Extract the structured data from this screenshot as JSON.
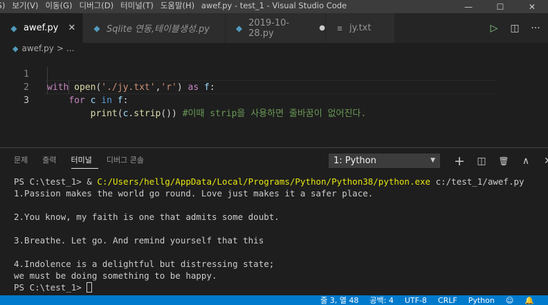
{
  "menu": [
    "선택(S)",
    "보기(V)",
    "이동(G)",
    "디버그(D)",
    "터미널(T)",
    "도움말(H)"
  ],
  "window_title": "awef.py - test_1 - Visual Studio Code",
  "window_controls": {
    "minimize": "—",
    "maximize": "☐",
    "close": "✕"
  },
  "tabs": [
    {
      "label": "awef.py",
      "icon": "python-icon",
      "active": true,
      "close": "✕"
    },
    {
      "label": "Sqlite 연동,테이블생성.py",
      "icon": "python-icon",
      "active": false
    },
    {
      "label": "2019-10-28.py",
      "icon": "python-icon",
      "active": false,
      "dot": "●"
    },
    {
      "label": "jy.txt",
      "icon": "text-file-icon",
      "active": false
    }
  ],
  "tab_actions": {
    "run": "▷",
    "split": "◫",
    "more": "···"
  },
  "breadcrumb": {
    "file": "awef.py",
    "sep": ">",
    "rest": "..."
  },
  "editor": {
    "lines": [
      {
        "num": "1",
        "tokens": [
          [
            "kw",
            "with"
          ],
          [
            "",
            " "
          ],
          [
            "fn",
            "open"
          ],
          [
            "",
            "("
          ],
          [
            "str",
            "'./jy.txt'"
          ],
          [
            "",
            ","
          ],
          [
            "str",
            "'r'"
          ],
          [
            "",
            ") "
          ],
          [
            "kw",
            "as"
          ],
          [
            "",
            " "
          ],
          [
            "var",
            "f"
          ],
          [
            "",
            ":"
          ]
        ]
      },
      {
        "num": "2",
        "tokens": [
          [
            "",
            "    "
          ],
          [
            "kw",
            "for"
          ],
          [
            "",
            " "
          ],
          [
            "var",
            "c"
          ],
          [
            "",
            " "
          ],
          [
            "kw2",
            "in"
          ],
          [
            "",
            " "
          ],
          [
            "var",
            "f"
          ],
          [
            "",
            ":"
          ]
        ]
      },
      {
        "num": "3",
        "tokens": [
          [
            "",
            "        "
          ],
          [
            "fn",
            "print"
          ],
          [
            "",
            "("
          ],
          [
            "var",
            "c"
          ],
          [
            "",
            "."
          ],
          [
            "fn",
            "strip"
          ],
          [
            "",
            "()) "
          ],
          [
            "cmt",
            "#이때 strip을 사용하면 줄바꿈이 없어진다."
          ]
        ]
      }
    ]
  },
  "panel": {
    "tabs": [
      {
        "label": "문제",
        "active": false
      },
      {
        "label": "출력",
        "active": false
      },
      {
        "label": "터미널",
        "active": true
      },
      {
        "label": "디버그 콘솔",
        "active": false
      }
    ],
    "terminal_select": "1: Python",
    "terminal_select_arrow": "▼",
    "actions": {
      "add": "+",
      "split": "◫",
      "trash": "🗑",
      "maximize": "∧",
      "close": "✕"
    }
  },
  "terminal": {
    "prompt": "PS C:\\test_1> & ",
    "python_path": "C:/Users/hellg/AppData/Local/Programs/Python/Python38/python.exe",
    "script_arg": " c:/test_1/awef.py",
    "output": [
      "1.Passion makes the world go round. Love just makes it a safer place.",
      "",
      "2.You know, my faith is one that admits some doubt.",
      "",
      "3.Breathe. Let go. And remind yourself that this",
      "",
      "4.Indolence is a delightful but distressing state;",
      "we must be doing something to be happy."
    ],
    "final_prompt": "PS C:\\test_1> "
  },
  "status": {
    "position": "줄 3, 열 48",
    "spaces": "공백: 4",
    "encoding": "UTF-8",
    "eol": "CRLF",
    "language": "Python",
    "feedback": "☺",
    "bell": "🔔"
  }
}
